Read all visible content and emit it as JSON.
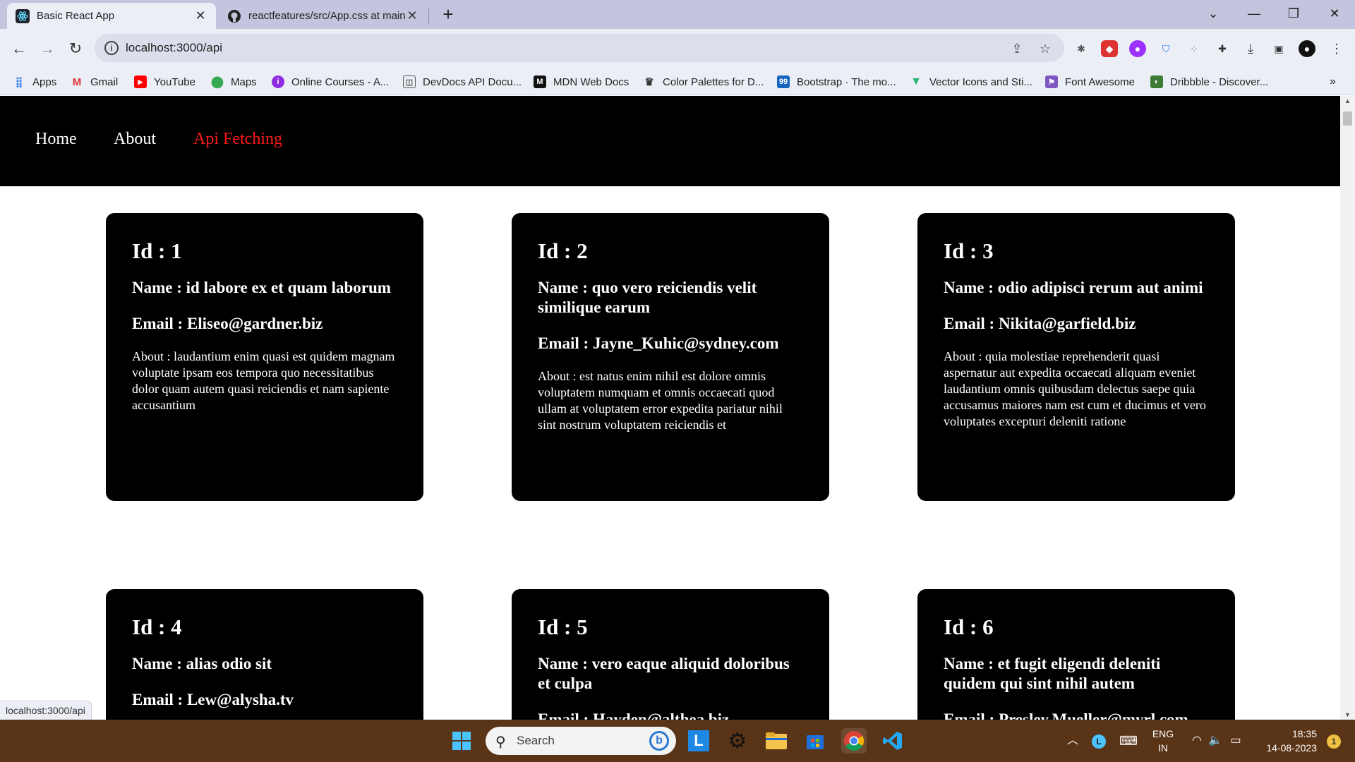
{
  "browser": {
    "tabs": [
      {
        "title": "Basic React App",
        "active": true
      },
      {
        "title": "reactfeatures/src/App.css at main",
        "active": false
      }
    ],
    "url": "localhost:3000/api",
    "bookmarks": [
      {
        "label": "Apps",
        "icon": "apps-grid-icon"
      },
      {
        "label": "Gmail",
        "icon": "gmail-icon"
      },
      {
        "label": "YouTube",
        "icon": "youtube-icon"
      },
      {
        "label": "Maps",
        "icon": "maps-icon"
      },
      {
        "label": "Online Courses - A...",
        "icon": "courses-icon"
      },
      {
        "label": "DevDocs API Docu...",
        "icon": "devdocs-icon"
      },
      {
        "label": "MDN Web Docs",
        "icon": "mdn-icon"
      },
      {
        "label": "Color Palettes for D...",
        "icon": "palette-icon"
      },
      {
        "label": "Bootstrap · The mo...",
        "icon": "bootstrap-icon"
      },
      {
        "label": "Vector Icons and Sti...",
        "icon": "vector-icon"
      },
      {
        "label": "Font Awesome",
        "icon": "fontawesome-icon"
      },
      {
        "label": "Dribbble - Discover...",
        "icon": "dribbble-icon"
      }
    ],
    "status_url": "localhost:3000/api"
  },
  "site": {
    "nav": [
      {
        "label": "Home",
        "active": false
      },
      {
        "label": "About",
        "active": false
      },
      {
        "label": "Api Fetching",
        "active": true
      }
    ],
    "active_color": "#ff1a1a",
    "cards": [
      {
        "id": "Id : 1",
        "name": "Name : id labore ex et quam laborum",
        "email": "Email : Eliseo@gardner.biz",
        "about": "About : laudantium enim quasi est quidem magnam voluptate ipsam eos tempora quo necessitatibus dolor quam autem quasi reiciendis et nam sapiente accusantium"
      },
      {
        "id": "Id : 2",
        "name": "Name : quo vero reiciendis velit similique earum",
        "email": "Email : Jayne_Kuhic@sydney.com",
        "about": "About : est natus enim nihil est dolore omnis voluptatem numquam et omnis occaecati quod ullam at voluptatem error expedita pariatur nihil sint nostrum voluptatem reiciendis et"
      },
      {
        "id": "Id : 3",
        "name": "Name : odio adipisci rerum aut animi",
        "email": "Email : Nikita@garfield.biz",
        "about": "About : quia molestiae reprehenderit quasi aspernatur aut expedita occaecati aliquam eveniet laudantium omnis quibusdam delectus saepe quia accusamus maiores nam est cum et ducimus et vero voluptates excepturi deleniti ratione"
      },
      {
        "id": "Id : 4",
        "name": "Name : alias odio sit",
        "email": "Email : Lew@alysha.tv",
        "about": ""
      },
      {
        "id": "Id : 5",
        "name": "Name : vero eaque aliquid doloribus et culpa",
        "email": "Email : Hayden@althea.biz",
        "about": ""
      },
      {
        "id": "Id : 6",
        "name": "Name : et fugit eligendi deleniti quidem qui sint nihil autem",
        "email": "Email : Presley.Mueller@myrl.com",
        "about": ""
      }
    ]
  },
  "taskbar": {
    "search_label": "Search",
    "language": "ENG",
    "region": "IN",
    "time": "18:35",
    "date": "14-08-2023",
    "notification_count": "1"
  }
}
